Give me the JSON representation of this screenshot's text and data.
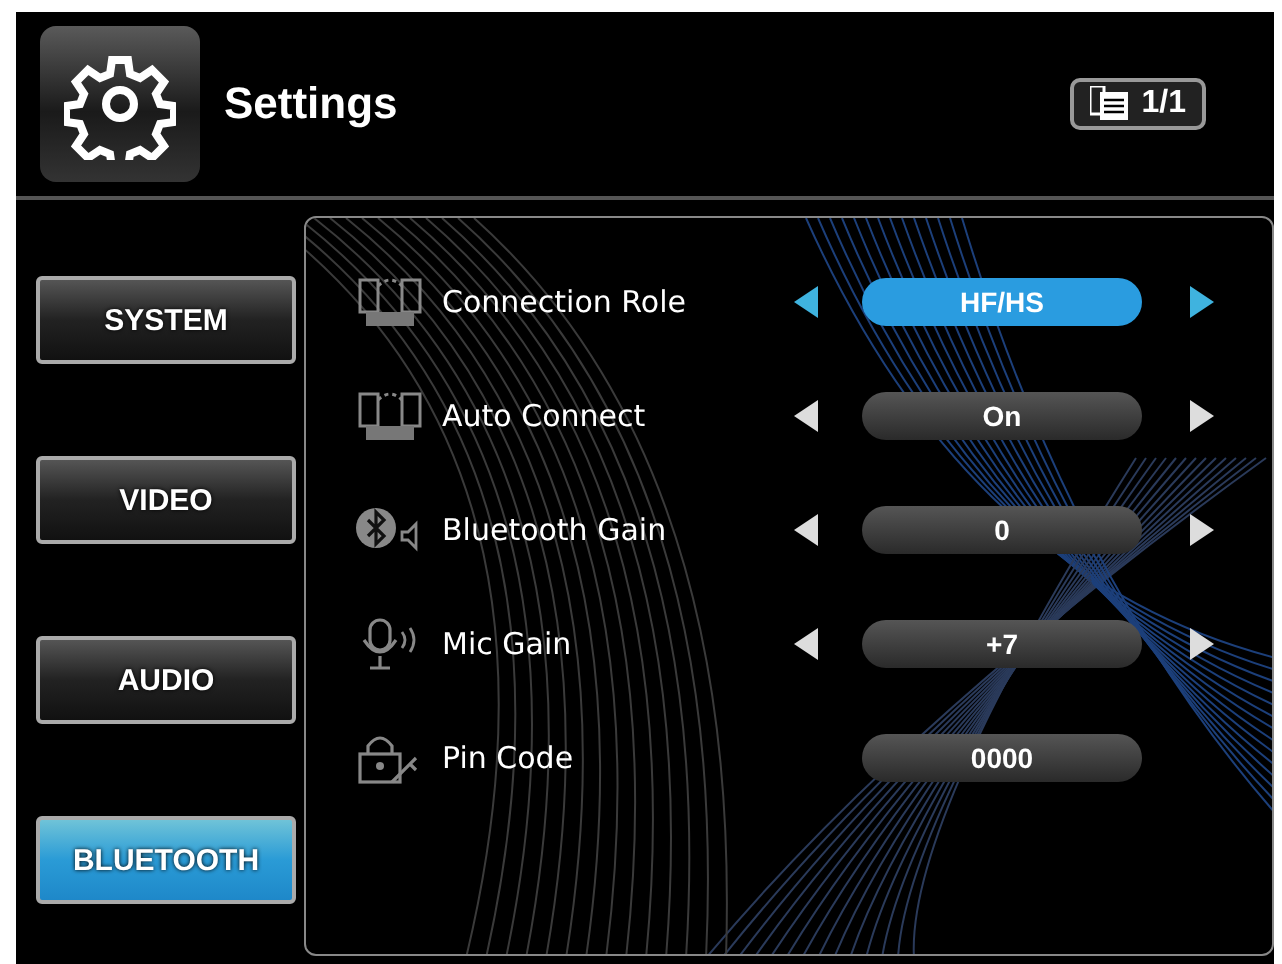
{
  "header": {
    "title": "Settings",
    "page_indicator": "1/1"
  },
  "sidebar": {
    "items": [
      {
        "label": "SYSTEM",
        "selected": false
      },
      {
        "label": "VIDEO",
        "selected": false
      },
      {
        "label": "AUDIO",
        "selected": false
      },
      {
        "label": "BLUETOOTH",
        "selected": true
      }
    ]
  },
  "settings": [
    {
      "kind": "selector",
      "label": "Connection Role",
      "value": "HF/HS",
      "selected": true
    },
    {
      "kind": "selector",
      "label": "Auto Connect",
      "value": "On",
      "selected": false
    },
    {
      "kind": "selector",
      "label": "Bluetooth Gain",
      "value": "0",
      "selected": false
    },
    {
      "kind": "selector",
      "label": "Mic Gain",
      "value": "+7",
      "selected": false
    },
    {
      "kind": "value",
      "label": "Pin Code",
      "value": "0000",
      "selected": false
    }
  ]
}
